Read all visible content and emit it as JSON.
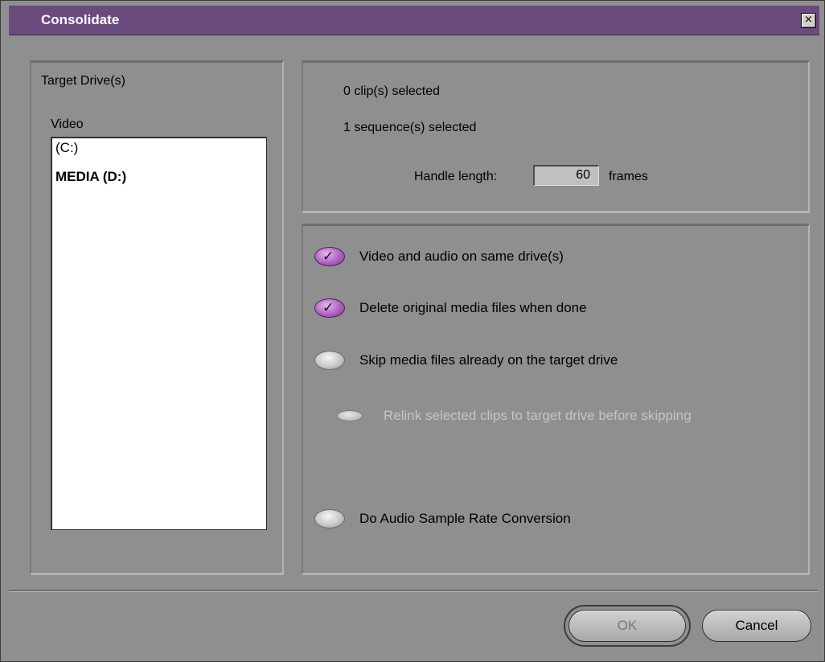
{
  "window": {
    "title": "Consolidate",
    "close_label": "×"
  },
  "target": {
    "heading": "Target Drive(s)",
    "video_label": "Video",
    "drives": [
      "(C:)",
      "MEDIA (D:)"
    ],
    "selected_drive": "MEDIA (D:)"
  },
  "summary": {
    "clips": "0 clip(s) selected",
    "sequences": "1 sequence(s) selected",
    "handle_label": "Handle length:",
    "handle_value": "60",
    "handle_unit": "frames"
  },
  "options": [
    {
      "label": "Video and audio on same drive(s)",
      "checked": true,
      "enabled": true
    },
    {
      "label": "Delete original media files when done",
      "checked": true,
      "enabled": true
    },
    {
      "label": "Skip media files already on the target drive",
      "checked": false,
      "enabled": true
    },
    {
      "label": "Relink selected clips to target drive before skipping",
      "checked": false,
      "enabled": false
    },
    {
      "label": "Do Audio Sample Rate Conversion",
      "checked": false,
      "enabled": true
    }
  ],
  "buttons": {
    "ok": "OK",
    "cancel": "Cancel"
  },
  "colors": {
    "title_bar": "#6b4a7e",
    "checkbox_on": "#b062c2",
    "background": "#8f8f8f"
  }
}
